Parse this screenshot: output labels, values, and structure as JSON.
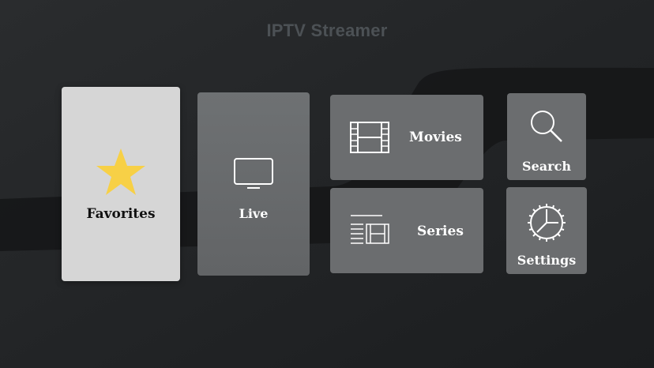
{
  "app": {
    "title": "IPTV Streamer"
  },
  "tiles": {
    "favorites": {
      "label": "Favorites",
      "icon": "star-icon"
    },
    "live": {
      "label": "Live",
      "icon": "tv-icon"
    },
    "movies": {
      "label": "Movies",
      "icon": "film-icon"
    },
    "series": {
      "label": "Series",
      "icon": "series-icon"
    },
    "search": {
      "label": "Search",
      "icon": "magnifier-icon"
    },
    "settings": {
      "label": "Settings",
      "icon": "gear-icon"
    }
  },
  "colors": {
    "background": "#1f2123",
    "tile": "#6b6d6f",
    "focused_tile": "#d6d6d6",
    "star": "#f7d046",
    "title": "#4c5155"
  }
}
